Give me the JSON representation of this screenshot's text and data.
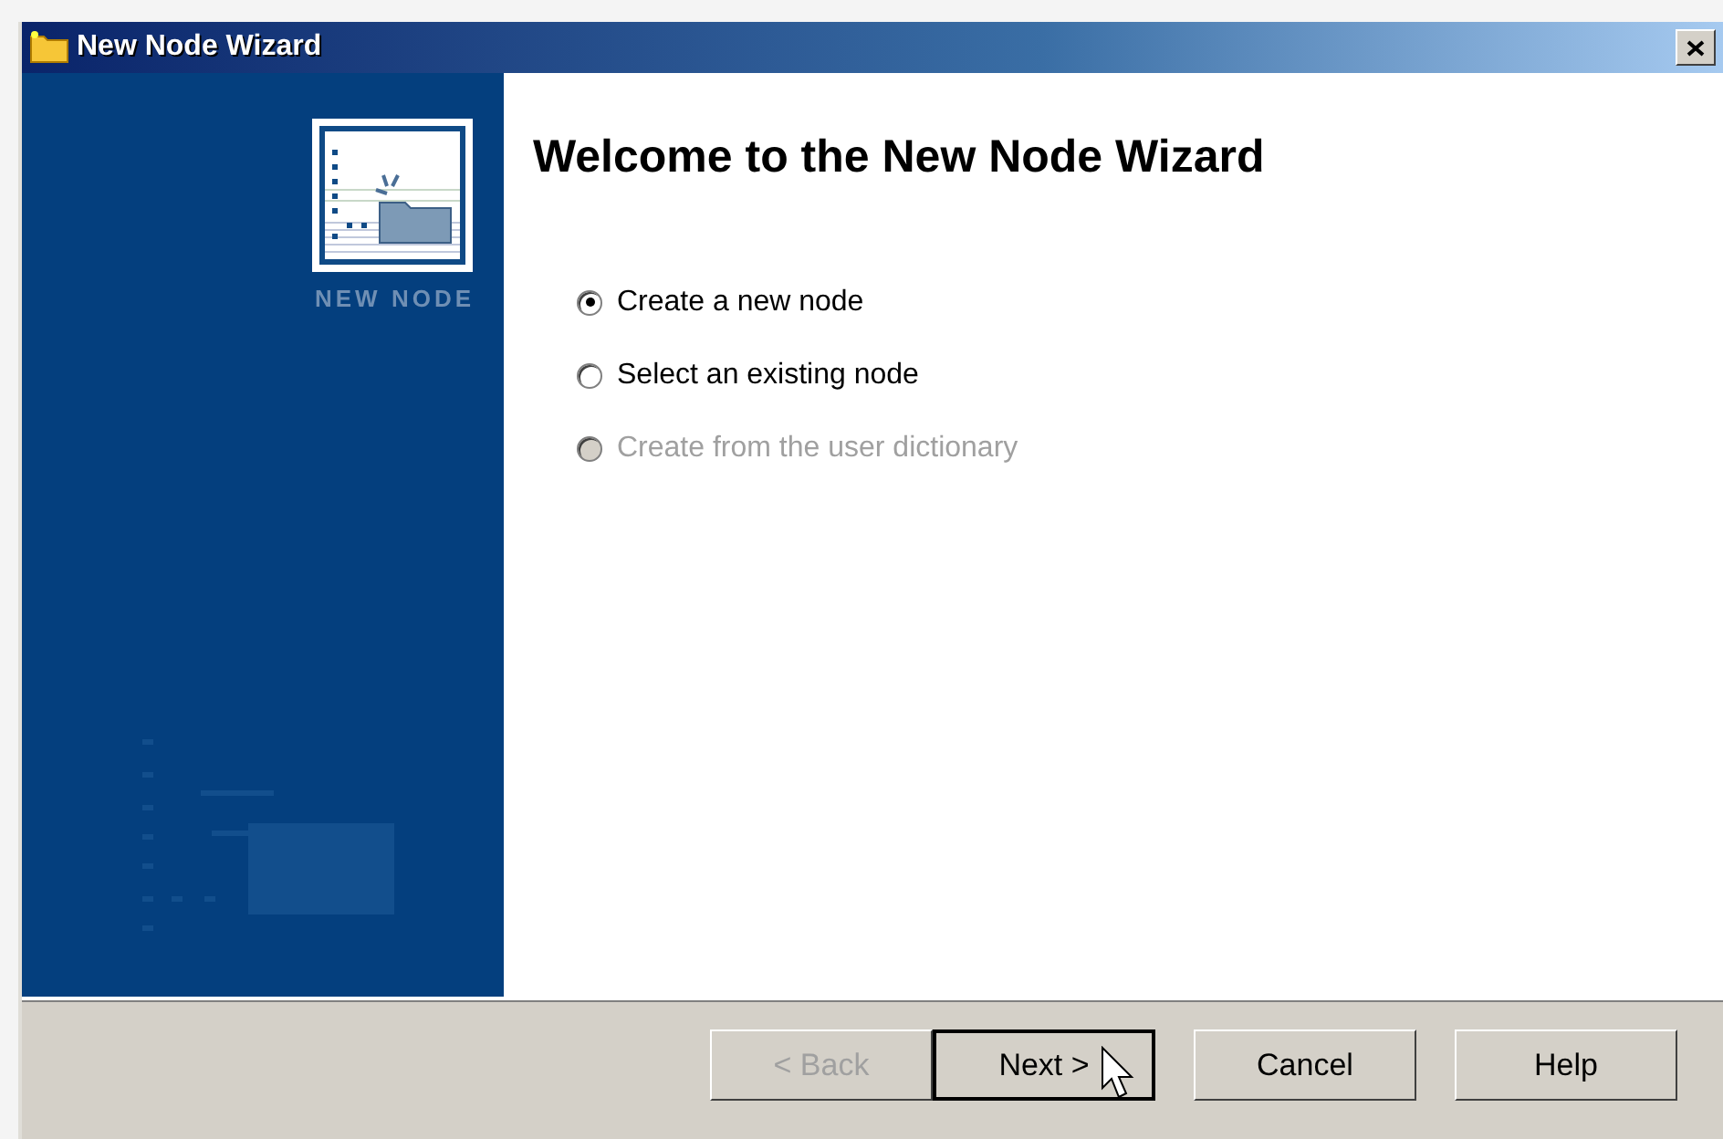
{
  "window": {
    "title": "New Node Wizard"
  },
  "sidebar": {
    "caption": "NEW NODE"
  },
  "heading": "Welcome to the New Node Wizard",
  "options": [
    {
      "label": "Create a new node",
      "selected": true,
      "disabled": false
    },
    {
      "label": "Select an existing node",
      "selected": false,
      "disabled": false
    },
    {
      "label": "Create from the user dictionary",
      "selected": false,
      "disabled": true
    }
  ],
  "buttons": [
    {
      "label": "< Back",
      "disabled": true,
      "default": false
    },
    {
      "label": "Next >",
      "disabled": false,
      "default": true
    },
    {
      "label": "Cancel",
      "disabled": false,
      "default": false
    },
    {
      "label": "Help",
      "disabled": false,
      "default": false
    }
  ]
}
